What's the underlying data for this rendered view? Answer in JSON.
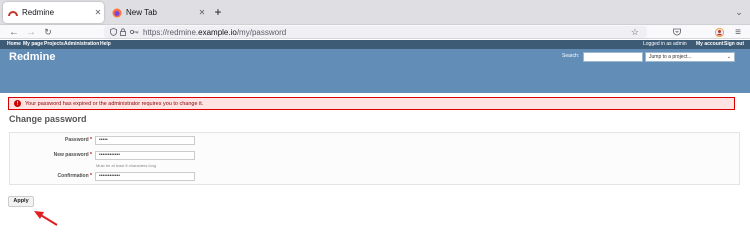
{
  "browser": {
    "tabs": [
      {
        "title": "Redmine"
      },
      {
        "title": "New Tab"
      }
    ],
    "url_prefix": "https://redmine.",
    "url_domain": "example.io",
    "url_path": "/my/password"
  },
  "top_menu": {
    "items": [
      "Home",
      "My page",
      "Projects",
      "Administration",
      "Help"
    ],
    "logged_in": "Logged in as admin",
    "my_account": "My account",
    "sign_out": "Sign out"
  },
  "header": {
    "title": "Redmine",
    "search_label": "Search:",
    "jump_placeholder": "Jump to a project..."
  },
  "flash": {
    "message": "Your password has expired or the administrator requires you to change it."
  },
  "page": {
    "title": "Change password",
    "fields": [
      {
        "label": "Password",
        "value": "•••••"
      },
      {
        "label": "New password",
        "value": "••••••••••••"
      },
      {
        "label": "Confirmation",
        "value": "••••••••••••"
      }
    ],
    "required_mark": "*",
    "hint": "Must be at least 8 characters long",
    "apply_label": "Apply"
  },
  "colors": {
    "header": "#628db6",
    "top_menu": "#3e5b76",
    "flash_bg": "#ffe3e3",
    "arrow": "#e02020"
  }
}
